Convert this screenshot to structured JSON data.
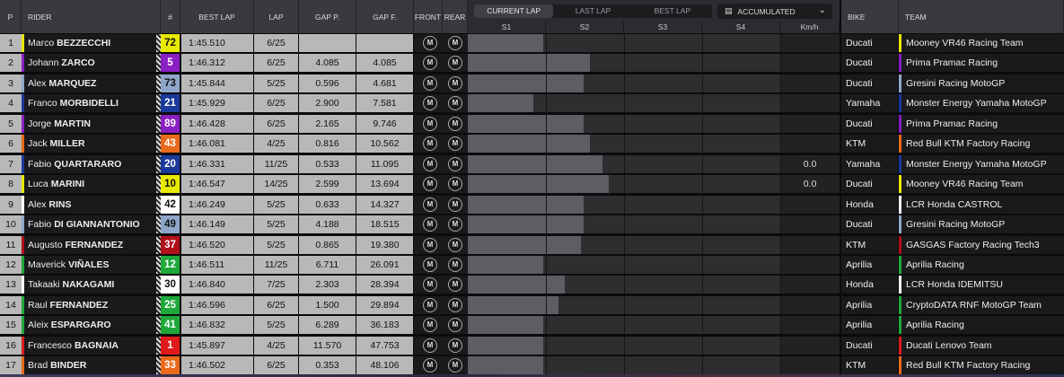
{
  "headers": {
    "pos": "P",
    "rider": "RIDER",
    "number": "#",
    "best_lap": "BEST LAP",
    "lap": "LAP",
    "gap_p": "GAP P.",
    "gap_f": "GAP F.",
    "front": "FRONT",
    "rear": "REAR",
    "bike": "BIKE",
    "team": "TEAM"
  },
  "lap_tabs": [
    {
      "label": "CURRENT LAP",
      "active": true
    },
    {
      "label": "LAST LAP",
      "active": false
    },
    {
      "label": "BEST LAP",
      "active": false
    }
  ],
  "accumulated_select": {
    "label": "ACCUMULATED",
    "icon": "bars-icon"
  },
  "sector_headers": [
    "S1",
    "S2",
    "S3",
    "S4",
    "Km/h"
  ],
  "tyre_glyph": "M",
  "riders": [
    {
      "pos": "1",
      "first": "Marco",
      "last": "BEZZECCHI",
      "number": "72",
      "num_bg": "#e8e800",
      "num_fg": "#111111",
      "best_lap": "1:45.510",
      "lap": "6/25",
      "gap_p": "",
      "gap_f": "",
      "bar": 0.24,
      "speed": "",
      "bike": "Ducati",
      "team": "Mooney VR46 Racing Team",
      "team_color": "#e8e800"
    },
    {
      "pos": "2",
      "first": "Johann",
      "last": "ZARCO",
      "number": "5",
      "num_bg": "#8a1fc2",
      "num_fg": "#ffffff",
      "best_lap": "1:46.312",
      "lap": "6/25",
      "gap_p": "4.085",
      "gap_f": "4.085",
      "bar": 0.39,
      "speed": "",
      "bike": "Ducati",
      "team": "Prima Pramac Racing",
      "team_color": "#8a1fc2"
    },
    {
      "pos": "3",
      "first": "Alex",
      "last": "MARQUEZ",
      "number": "73",
      "num_bg": "#8fa6c8",
      "num_fg": "#111111",
      "best_lap": "1:45.844",
      "lap": "5/25",
      "gap_p": "0.596",
      "gap_f": "4.681",
      "bar": 0.37,
      "speed": "",
      "bike": "Ducati",
      "team": "Gresini Racing MotoGP",
      "team_color": "#8fa6c8"
    },
    {
      "pos": "4",
      "first": "Franco",
      "last": "MORBIDELLI",
      "number": "21",
      "num_bg": "#1a3a9a",
      "num_fg": "#ffffff",
      "best_lap": "1:45.929",
      "lap": "6/25",
      "gap_p": "2.900",
      "gap_f": "7.581",
      "bar": 0.21,
      "speed": "",
      "bike": "Yamaha",
      "team": "Monster Energy Yamaha MotoGP",
      "team_color": "#1a3a9a"
    },
    {
      "pos": "5",
      "first": "Jorge",
      "last": "MARTIN",
      "number": "89",
      "num_bg": "#8a1fc2",
      "num_fg": "#ffffff",
      "best_lap": "1:46.428",
      "lap": "6/25",
      "gap_p": "2.165",
      "gap_f": "9.746",
      "bar": 0.37,
      "speed": "",
      "bike": "Ducati",
      "team": "Prima Pramac Racing",
      "team_color": "#8a1fc2"
    },
    {
      "pos": "6",
      "first": "Jack",
      "last": "MILLER",
      "number": "43",
      "num_bg": "#e86a1a",
      "num_fg": "#ffffff",
      "best_lap": "1:46.081",
      "lap": "4/25",
      "gap_p": "0.816",
      "gap_f": "10.562",
      "bar": 0.39,
      "speed": "",
      "bike": "KTM",
      "team": "Red Bull KTM Factory Racing",
      "team_color": "#e86a1a"
    },
    {
      "pos": "7",
      "first": "Fabio",
      "last": "QUARTARARO",
      "number": "20",
      "num_bg": "#1a3a9a",
      "num_fg": "#ffffff",
      "best_lap": "1:46.331",
      "lap": "11/25",
      "gap_p": "0.533",
      "gap_f": "11.095",
      "bar": 0.43,
      "speed": "0.0",
      "bike": "Yamaha",
      "team": "Monster Energy Yamaha MotoGP",
      "team_color": "#1a3a9a"
    },
    {
      "pos": "8",
      "first": "Luca",
      "last": "MARINI",
      "number": "10",
      "num_bg": "#e8e800",
      "num_fg": "#111111",
      "best_lap": "1:46.547",
      "lap": "14/25",
      "gap_p": "2.599",
      "gap_f": "13.694",
      "bar": 0.45,
      "speed": "0.0",
      "bike": "Ducati",
      "team": "Mooney VR46 Racing Team",
      "team_color": "#e8e800"
    },
    {
      "pos": "9",
      "first": "Alex",
      "last": "RINS",
      "number": "42",
      "num_bg": "#ffffff",
      "num_fg": "#111111",
      "best_lap": "1:46.249",
      "lap": "5/25",
      "gap_p": "0.633",
      "gap_f": "14.327",
      "bar": 0.37,
      "speed": "",
      "bike": "Honda",
      "team": "LCR Honda CASTROL",
      "team_color": "#ffffff"
    },
    {
      "pos": "10",
      "first": "Fabio",
      "last": "DI GIANNANTONIO",
      "number": "49",
      "num_bg": "#8fa6c8",
      "num_fg": "#111111",
      "best_lap": "1:46.149",
      "lap": "5/25",
      "gap_p": "4.188",
      "gap_f": "18.515",
      "bar": 0.37,
      "speed": "",
      "bike": "Ducati",
      "team": "Gresini Racing MotoGP",
      "team_color": "#8fa6c8"
    },
    {
      "pos": "11",
      "first": "Augusto",
      "last": "FERNANDEZ",
      "number": "37",
      "num_bg": "#b0101a",
      "num_fg": "#ffffff",
      "best_lap": "1:46.520",
      "lap": "5/25",
      "gap_p": "0.865",
      "gap_f": "19.380",
      "bar": 0.36,
      "speed": "",
      "bike": "KTM",
      "team": "GASGAS Factory Racing Tech3",
      "team_color": "#b0101a"
    },
    {
      "pos": "12",
      "first": "Maverick",
      "last": "VIÑALES",
      "number": "12",
      "num_bg": "#1fa83a",
      "num_fg": "#ffffff",
      "best_lap": "1:46.511",
      "lap": "11/25",
      "gap_p": "6.711",
      "gap_f": "26.091",
      "bar": 0.24,
      "speed": "",
      "bike": "Aprilia",
      "team": "Aprilia Racing",
      "team_color": "#1fa83a"
    },
    {
      "pos": "13",
      "first": "Takaaki",
      "last": "NAKAGAMI",
      "number": "30",
      "num_bg": "#ffffff",
      "num_fg": "#111111",
      "best_lap": "1:46.840",
      "lap": "7/25",
      "gap_p": "2.303",
      "gap_f": "28.394",
      "bar": 0.31,
      "speed": "",
      "bike": "Honda",
      "team": "LCR Honda IDEMITSU",
      "team_color": "#ffffff"
    },
    {
      "pos": "14",
      "first": "Raul",
      "last": "FERNANDEZ",
      "number": "25",
      "num_bg": "#1fa83a",
      "num_fg": "#ffffff",
      "best_lap": "1:46.596",
      "lap": "6/25",
      "gap_p": "1.500",
      "gap_f": "29.894",
      "bar": 0.29,
      "speed": "",
      "bike": "Aprilia",
      "team": "CryptoDATA RNF MotoGP Team",
      "team_color": "#1fa83a"
    },
    {
      "pos": "15",
      "first": "Aleix",
      "last": "ESPARGARO",
      "number": "41",
      "num_bg": "#1fa83a",
      "num_fg": "#ffffff",
      "best_lap": "1:46.832",
      "lap": "5/25",
      "gap_p": "6.289",
      "gap_f": "36.183",
      "bar": 0.24,
      "speed": "",
      "bike": "Aprilia",
      "team": "Aprilia Racing",
      "team_color": "#1fa83a"
    },
    {
      "pos": "16",
      "first": "Francesco",
      "last": "BAGNAIA",
      "number": "1",
      "num_bg": "#e01a1a",
      "num_fg": "#ffffff",
      "best_lap": "1:45.897",
      "lap": "4/25",
      "gap_p": "11.570",
      "gap_f": "47.753",
      "bar": 0.24,
      "speed": "",
      "bike": "Ducati",
      "team": "Ducati Lenovo Team",
      "team_color": "#e01a1a"
    },
    {
      "pos": "17",
      "first": "Brad",
      "last": "BINDER",
      "number": "33",
      "num_bg": "#e86a1a",
      "num_fg": "#ffffff",
      "best_lap": "1:46.502",
      "lap": "6/25",
      "gap_p": "0.353",
      "gap_f": "48.106",
      "bar": 0.24,
      "speed": "",
      "bike": "KTM",
      "team": "Red Bull KTM Factory Racing",
      "team_color": "#e86a1a"
    }
  ]
}
